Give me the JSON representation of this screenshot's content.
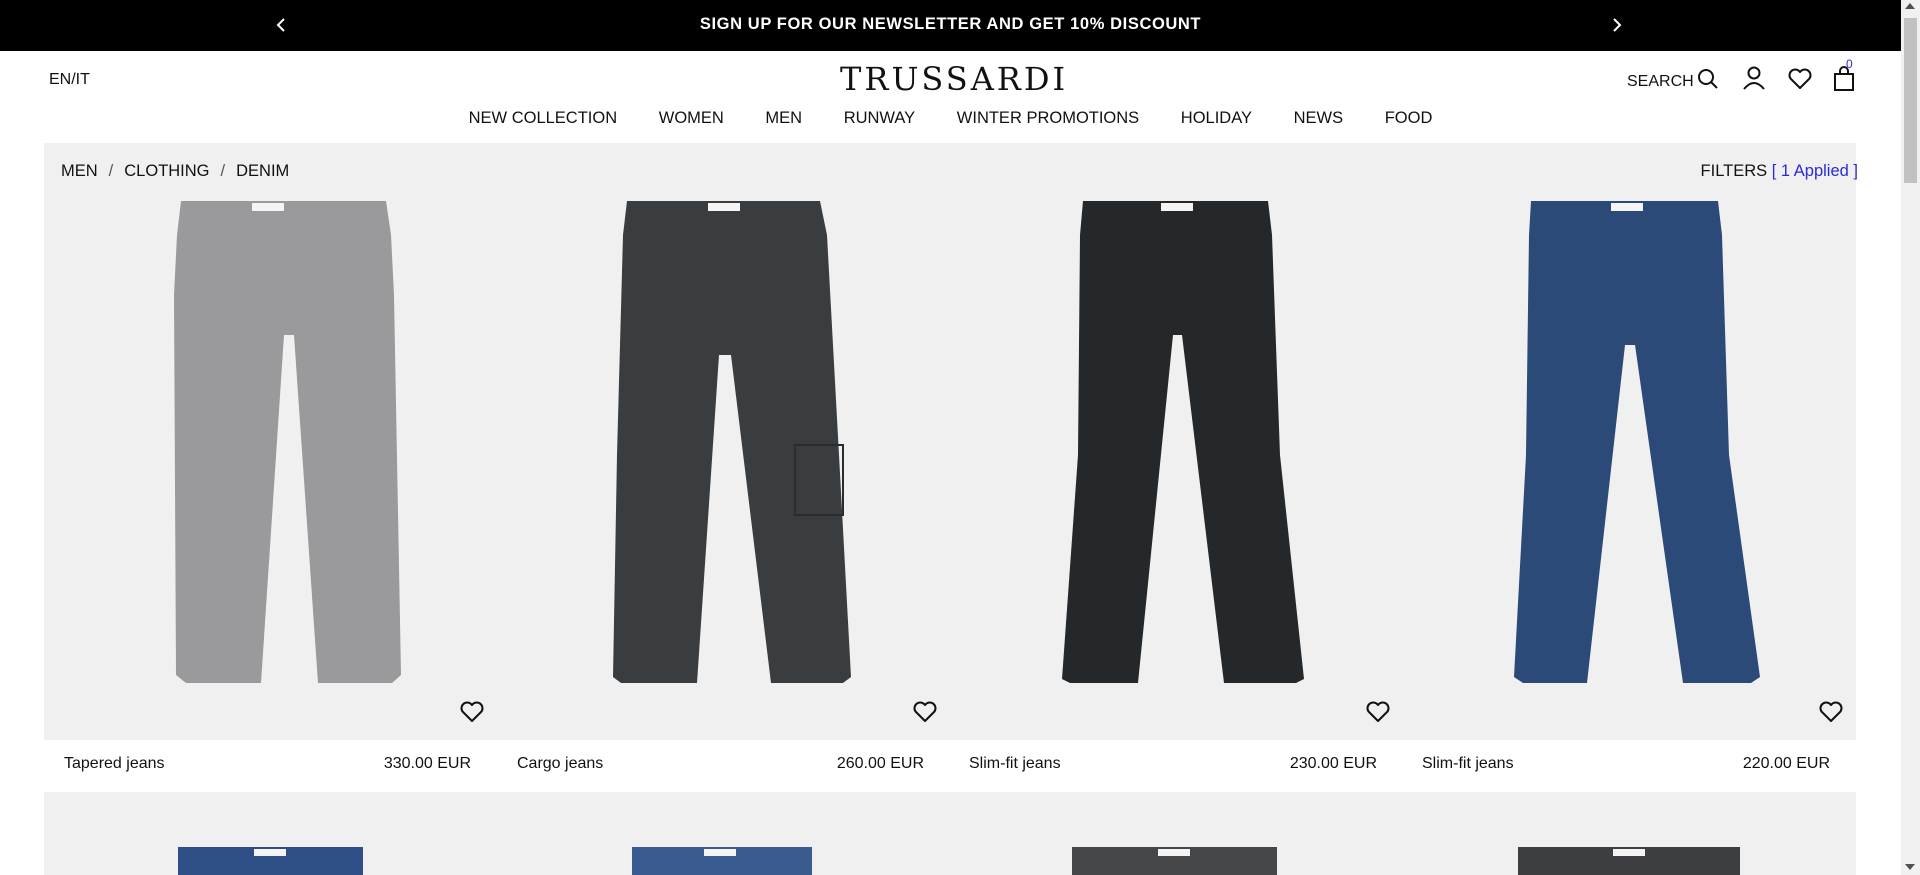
{
  "promo": {
    "message": "SIGN UP FOR OUR NEWSLETTER AND GET 10% DISCOUNT",
    "prev_icon": "chevron-left-icon",
    "next_icon": "chevron-right-icon"
  },
  "header": {
    "language": "EN/IT",
    "logo": "TRUSSARDI",
    "search_label": "SEARCH",
    "cart_count": "0",
    "icons": [
      "search-icon",
      "account-icon",
      "heart-icon",
      "bag-icon"
    ]
  },
  "nav": {
    "items": [
      "NEW COLLECTION",
      "WOMEN",
      "MEN",
      "RUNWAY",
      "WINTER PROMOTIONS",
      "HOLIDAY",
      "NEWS",
      "FOOD"
    ]
  },
  "breadcrumb": {
    "items": [
      "MEN",
      "CLOTHING",
      "DENIM"
    ]
  },
  "filters": {
    "label": "FILTERS",
    "applied": "[ 1 Applied ]"
  },
  "products": [
    {
      "name": "Tapered jeans",
      "price": "330.00 EUR",
      "color": "#9a9a9c"
    },
    {
      "name": "Cargo jeans",
      "price": "260.00 EUR",
      "color": "#3a3d40"
    },
    {
      "name": "Slim-fit jeans",
      "price": "230.00 EUR",
      "color": "#25282a"
    },
    {
      "name": "Slim-fit jeans",
      "price": "220.00 EUR",
      "color": "#2c4a78"
    }
  ],
  "row2_colors": [
    "#2d4f86",
    "#3a5b8f",
    "#444648",
    "#3c3e41"
  ]
}
